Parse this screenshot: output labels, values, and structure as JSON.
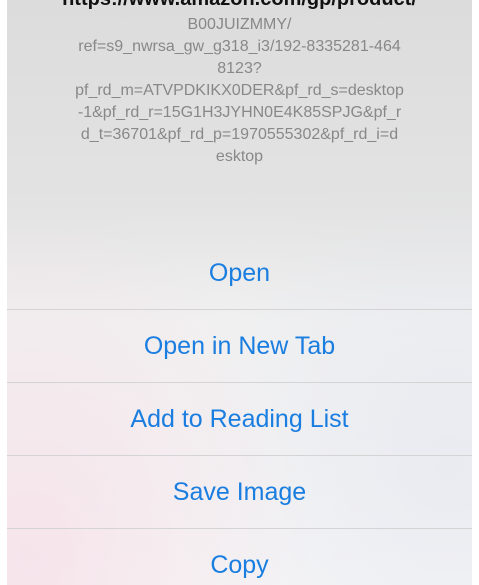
{
  "url_popup": {
    "top_cut_text": "https://www.amazon.com/gp/product/",
    "url_lines": [
      "B00JUIZMMY/",
      "ref=s9_nwrsa_gw_g318_i3/192-8335281-464",
      "8123?",
      "pf_rd_m=ATVPDKIKX0DER&pf_rd_s=desktop",
      "-1&pf_rd_r=15G1H3JYHN0E4K85SPJG&pf_r",
      "d_t=36701&pf_rd_p=1970555302&pf_rd_i=d",
      "esktop"
    ]
  },
  "actions": {
    "open": "Open",
    "open_new_tab": "Open in New Tab",
    "add_reading_list": "Add to Reading List",
    "save_image": "Save Image",
    "copy": "Copy"
  },
  "colors": {
    "action_text": "#1a7de0",
    "url_text": "#888888",
    "separator": "#d4d4d4"
  }
}
